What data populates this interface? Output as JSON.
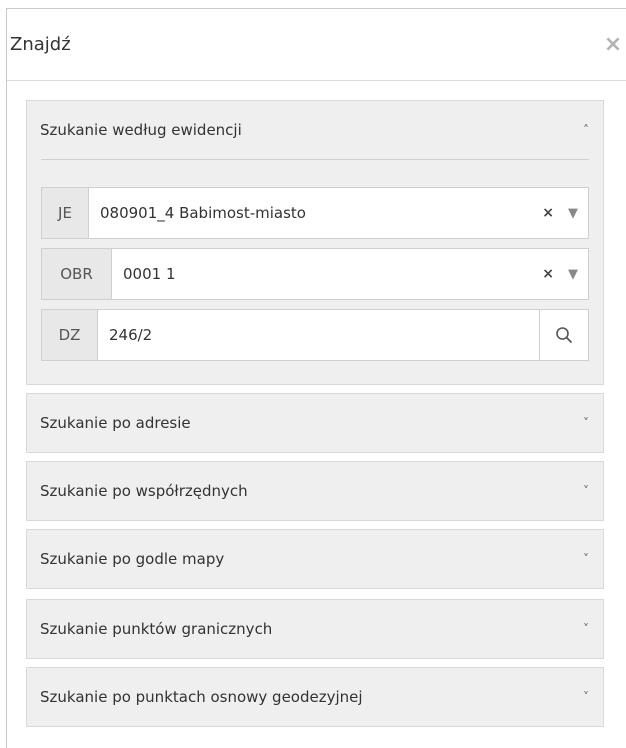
{
  "panel": {
    "title": "Znajdź",
    "close_label": "×"
  },
  "active_section": {
    "title": "Szukanie według ewidencji",
    "chevron": "˄",
    "fields": [
      {
        "label": "JE",
        "value": "080901_4 Babimost-miasto",
        "clear": "×",
        "dropdown": "▼"
      },
      {
        "label": "OBR",
        "value": "0001 1",
        "clear": "×",
        "dropdown": "▼"
      },
      {
        "label": "DZ",
        "value": "246/2"
      }
    ]
  },
  "sections": [
    {
      "title": "Szukanie po adresie",
      "chevron": "˅"
    },
    {
      "title": "Szukanie po współrzędnych",
      "chevron": "˅"
    },
    {
      "title": "Szukanie po godle mapy",
      "chevron": "˅"
    },
    {
      "title": "Szukanie punktów granicznych",
      "chevron": "˅"
    },
    {
      "title": "Szukanie po punktach osnowy geodezyjnej",
      "chevron": "˅"
    }
  ]
}
